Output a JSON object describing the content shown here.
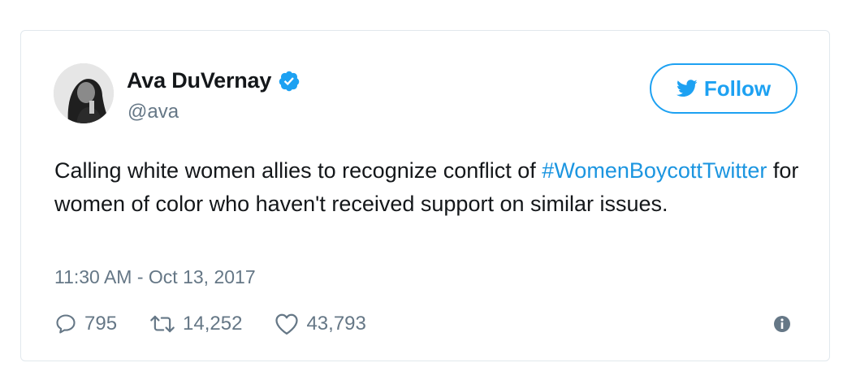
{
  "user": {
    "display_name": "Ava DuVernay",
    "handle": "@ava",
    "verified": true,
    "avatar_icon": "profile-photo"
  },
  "follow_button": {
    "label": "Follow",
    "icon": "twitter-bird-icon",
    "color": "#1da1f2"
  },
  "tweet": {
    "text_before": "Calling white women allies to recognize conflict of ",
    "hashtag": "#WomenBoycottTwitter",
    "text_after": " for women of color who haven't received support on similar issues.",
    "timestamp": "11:30 AM - Oct 13, 2017"
  },
  "actions": {
    "replies": "795",
    "retweets": "14,252",
    "likes": "43,793"
  },
  "colors": {
    "text": "#14171a",
    "secondary": "#657786",
    "link": "#1b95e0",
    "border": "#e1e8ed"
  }
}
